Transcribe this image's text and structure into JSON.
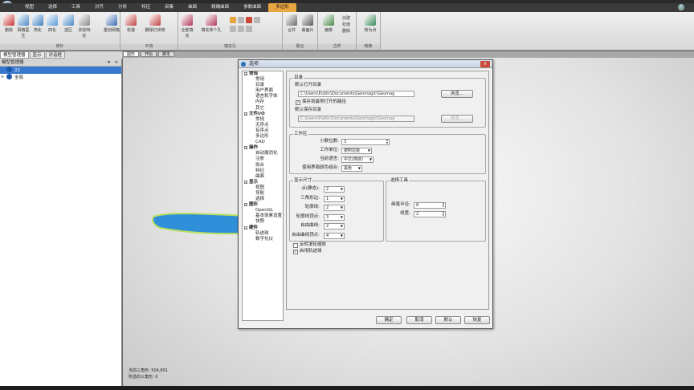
{
  "menu": [
    "视图",
    "选择",
    "工具",
    "对齐",
    "分析",
    "特征",
    "采集",
    "曲面",
    "精确曲面",
    "参数曲面",
    "多边形"
  ],
  "menu_active_index": 10,
  "ribbon": {
    "buttons": [
      {
        "label": "删除",
        "color": "#c33"
      },
      {
        "label": "网格医生",
        "color": "#4a8ac9"
      },
      {
        "label": "简化",
        "color": "#3a7dc0"
      },
      {
        "label": "四化",
        "color": "#5a9ad9"
      },
      {
        "label": "选区",
        "color": "#4a8ac9"
      },
      {
        "label": "去除特征",
        "color": "#8a8a8a"
      },
      {
        "label": "重划网格",
        "color": "#3a6ab0"
      },
      {
        "label": "松弛",
        "color": "#c04040"
      },
      {
        "label": "删除钉状物",
        "color": "#c04040"
      },
      {
        "label": "全部填充",
        "color": "#b03a5a"
      },
      {
        "label": "填充单个孔",
        "color": "#b03a5a"
      },
      {
        "label": "合并",
        "color": "#6a6a6a"
      },
      {
        "label": "曲面片",
        "color": "#5a5a5a"
      },
      {
        "label": "偏移",
        "color": "#4a8a4a"
      },
      {
        "label": "转为点",
        "color": "#3a8a5a"
      }
    ],
    "small_items": [
      "创建",
      "松弛",
      "删除"
    ],
    "groups": [
      "修补",
      "平滑",
      "填充孔",
      "联合",
      "边界",
      "转换"
    ]
  },
  "left_tabs": [
    "模型管理器",
    "显示",
    "对话框"
  ],
  "left_panel": {
    "title": "模型管理器",
    "pin": "▾",
    "close": "×",
    "items": [
      {
        "label": "22",
        "selected": true
      },
      {
        "label": "全局",
        "selected": false
      }
    ]
  },
  "viewport_tabs": [
    "图形",
    "开始",
    "脚本"
  ],
  "status": {
    "line1": "当前三角形: 504,801",
    "line2": "所选的三角形: 0"
  },
  "dialog": {
    "title": "选项",
    "close": "X",
    "nav": [
      {
        "label": "常规",
        "cat": true
      },
      {
        "label": "常用",
        "cat": false
      },
      {
        "label": "目录",
        "cat": false
      },
      {
        "label": "用户界面",
        "cat": false
      },
      {
        "label": "语言和字体",
        "cat": false
      },
      {
        "label": "内存",
        "cat": false
      },
      {
        "label": "其它",
        "cat": false
      },
      {
        "label": "文件I/O",
        "cat": true
      },
      {
        "label": "常规",
        "cat": false
      },
      {
        "label": "无序点",
        "cat": false
      },
      {
        "label": "有序点",
        "cat": false
      },
      {
        "label": "多边形",
        "cat": false
      },
      {
        "label": "CAD",
        "cat": false
      },
      {
        "label": "操作",
        "cat": true
      },
      {
        "label": "自动撤消化",
        "cat": false
      },
      {
        "label": "注册",
        "cat": false
      },
      {
        "label": "拟合",
        "cat": false
      },
      {
        "label": "特征",
        "cat": false
      },
      {
        "label": "曲面",
        "cat": false
      },
      {
        "label": "显示",
        "cat": true
      },
      {
        "label": "视图",
        "cat": false
      },
      {
        "label": "导航",
        "cat": false
      },
      {
        "label": "选择",
        "cat": false
      },
      {
        "label": "图形",
        "cat": true
      },
      {
        "label": "OpenGL",
        "cat": false
      },
      {
        "label": "基本体素设置",
        "cat": false
      },
      {
        "label": "快照",
        "cat": false
      },
      {
        "label": "硬件",
        "cat": true
      },
      {
        "label": "轨迹球",
        "cat": false
      },
      {
        "label": "数字化仪",
        "cat": false
      }
    ],
    "dir": {
      "group": "目录",
      "open_label": "默认打开目录",
      "open_path": "C:\\Users\\Public\\Documents\\Geomagic\\Geomag",
      "browse": "浏览...",
      "save_recent": "保存到最常打开的路径",
      "save_label": "默认保存目录",
      "save_path": "C:\\Users\\Public\\Documents\\Geomagic\\Geomag",
      "browse2": "浏览..."
    },
    "work": {
      "group": "工作区",
      "decimals_label": "小数位数:",
      "decimals": "3",
      "units_label": "工作单位:",
      "units": "按照拉能",
      "lang_label": "当前语言:",
      "lang": "中文(简体)",
      "color_label": "使用界面颜色组合:",
      "color": "黑色"
    },
    "disp": {
      "group": "显示尺寸",
      "rows": [
        {
          "label": "点(静态):",
          "value": "2"
        },
        {
          "label": "三角形边:",
          "value": "1"
        },
        {
          "label": "轮廓线:",
          "value": "2"
        },
        {
          "label": "轮廓线顶点:",
          "value": "3"
        },
        {
          "label": "自由曲线:",
          "value": "2"
        },
        {
          "label": "自由曲线顶点:",
          "value": "4"
        }
      ]
    },
    "sel": {
      "group": "选择工具",
      "brush_label": "画笔半径:",
      "brush": "8",
      "line_label": "线宽:",
      "line": "2"
    },
    "chk_reverse": "反转滚轮缩放",
    "chk_trackball": "启用轨迹球",
    "buttons": {
      "ok": "确定",
      "cancel": "取消",
      "default": "默认",
      "restore": "恢复"
    }
  }
}
